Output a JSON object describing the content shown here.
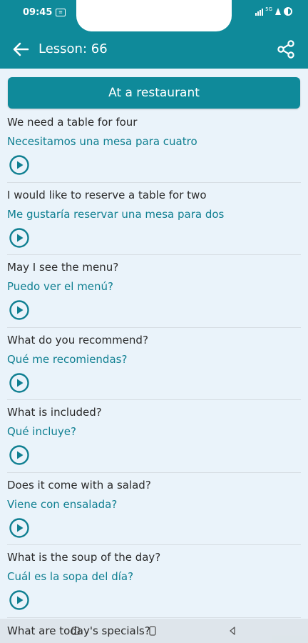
{
  "status_bar": {
    "time": "09:45",
    "network": "5G"
  },
  "app_bar": {
    "title": "Lesson: 66"
  },
  "lesson": {
    "title": "At a restaurant"
  },
  "phrases": [
    {
      "english": "We need a table for four",
      "spanish": "Necesitamos una mesa para cuatro"
    },
    {
      "english": "I would like to reserve a table for two",
      "spanish": "Me gustaría reservar una mesa para dos"
    },
    {
      "english": "May I see the menu?",
      "spanish": "Puedo ver el menú?"
    },
    {
      "english": "What do you recommend?",
      "spanish": "Qué me recomiendas?"
    },
    {
      "english": "What is included?",
      "spanish": "Qué incluye?"
    },
    {
      "english": "Does it come with a salad?",
      "spanish": "Viene con ensalada?"
    },
    {
      "english": "What is the soup of the day?",
      "spanish": "Cuál es la sopa del día?"
    }
  ],
  "partial_phrase": {
    "english": "What are today's specials?"
  },
  "colors": {
    "primary": "#0f8a9a",
    "background": "#eaf3fa",
    "spanish_text": "#0f7f91"
  }
}
